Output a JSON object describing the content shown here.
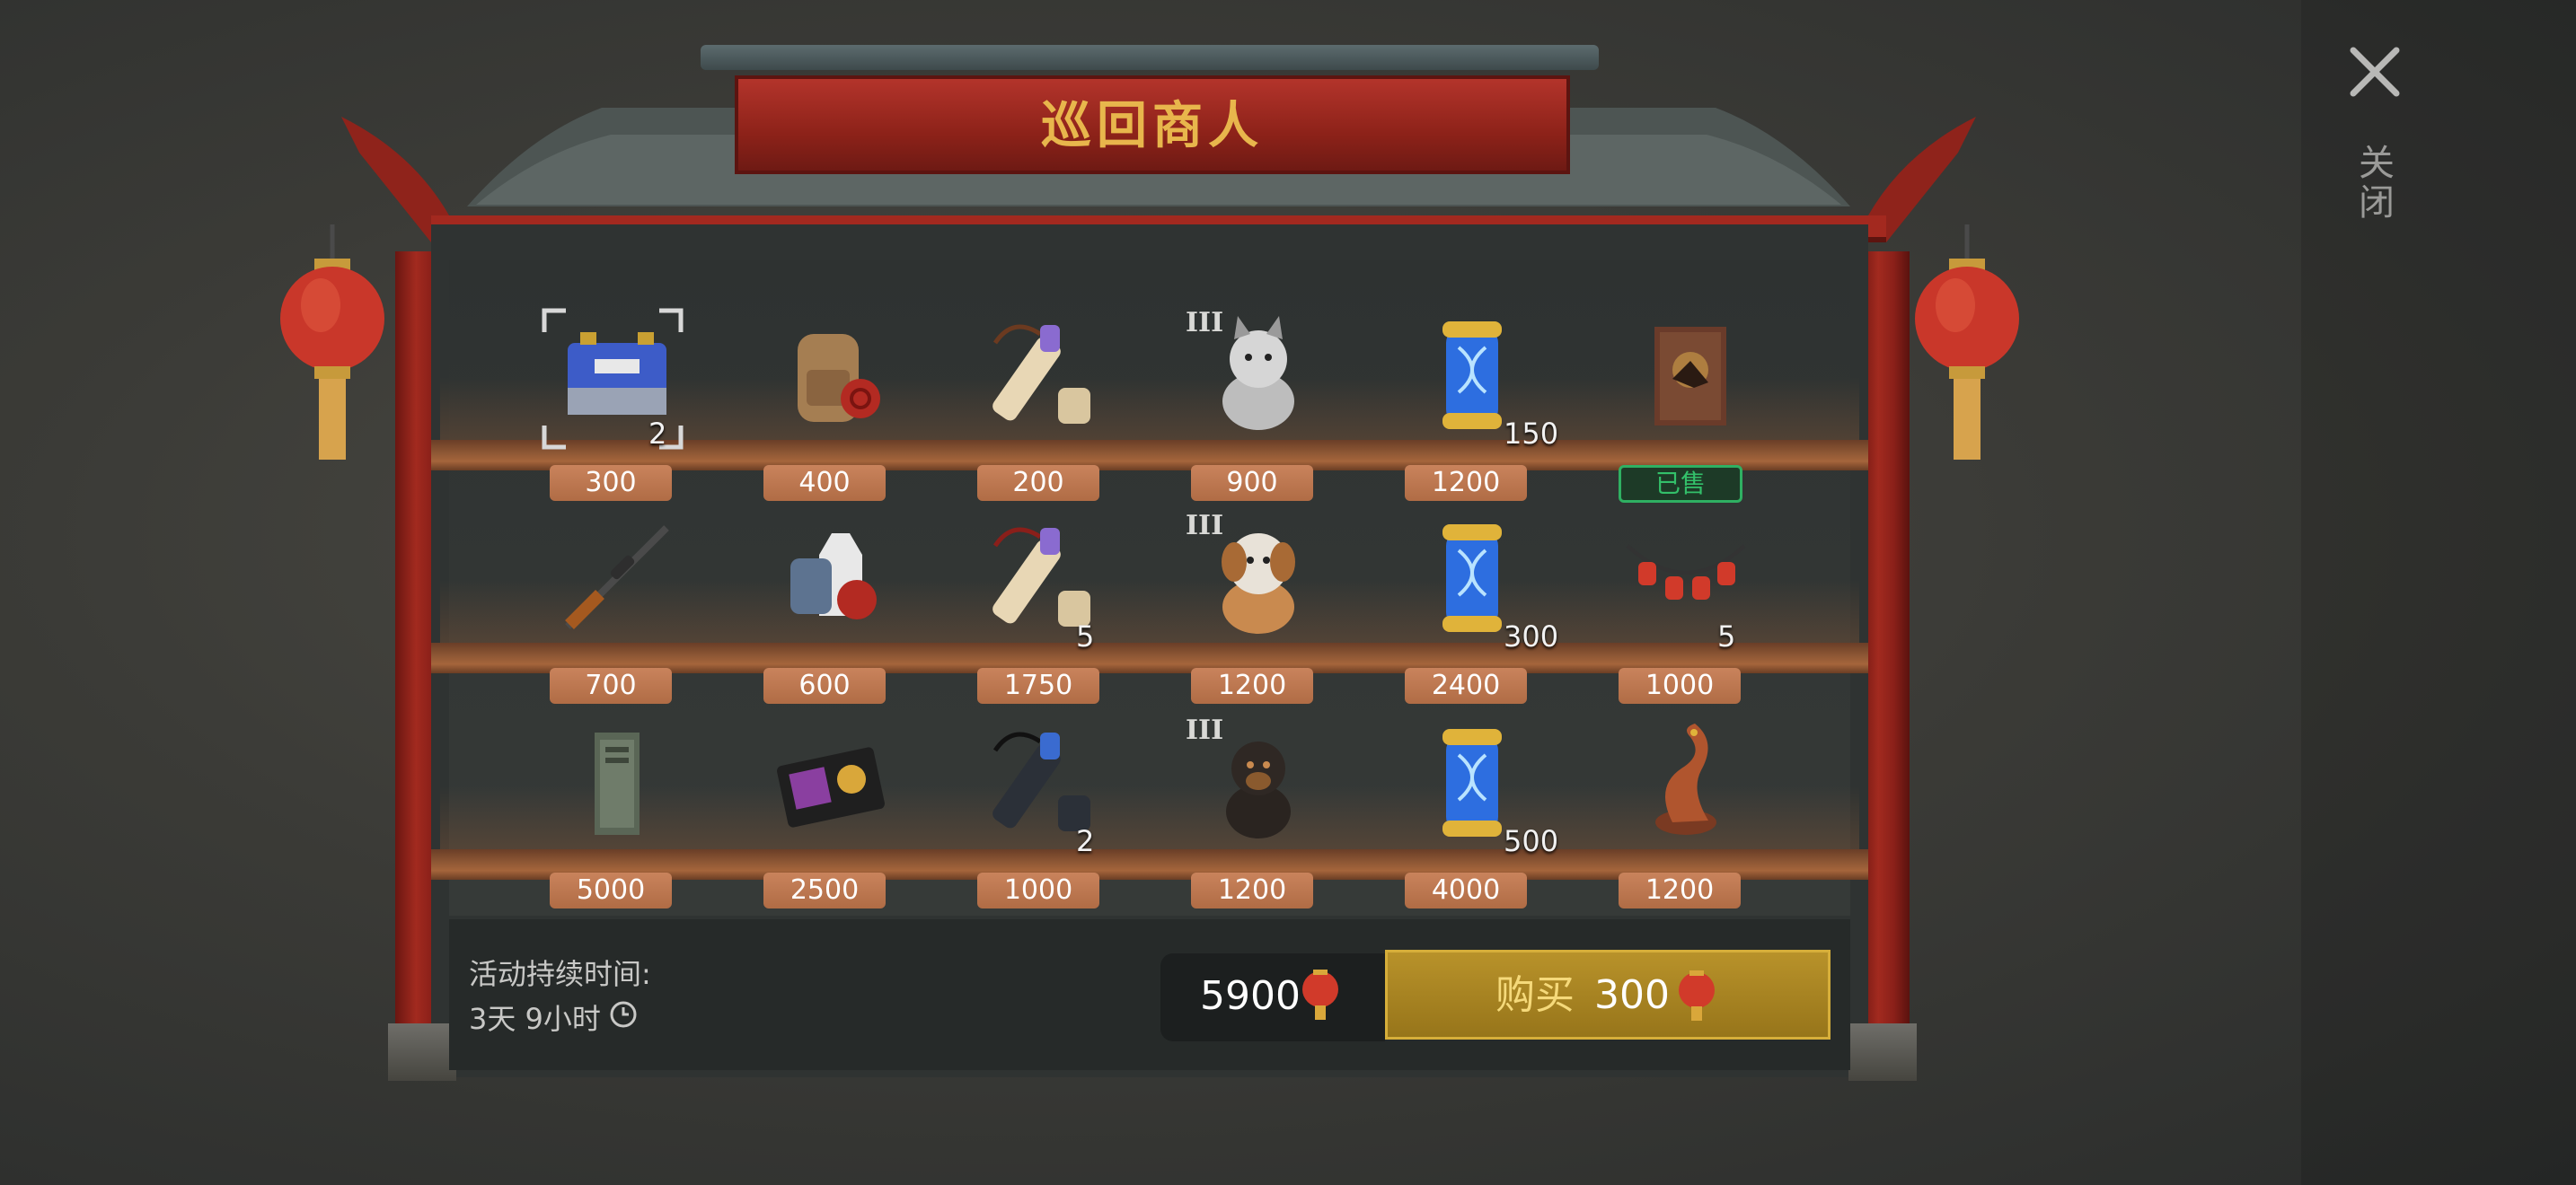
{
  "header": {
    "title": "巡回商人"
  },
  "close": {
    "label": "关闭"
  },
  "footer": {
    "duration_label": "活动持续时间:",
    "duration_value": "3天 9小时",
    "balance": "5900",
    "buy_label": "购买",
    "buy_price": "300"
  },
  "items": [
    {
      "name": "battery-item",
      "price": "300",
      "qty": "2",
      "tier": "",
      "sold": false,
      "selected": true
    },
    {
      "name": "backpack-item",
      "price": "400",
      "qty": "",
      "tier": "",
      "sold": false
    },
    {
      "name": "scroll-item",
      "price": "200",
      "qty": "",
      "tier": "",
      "sold": false
    },
    {
      "name": "husky-puppy-item",
      "price": "900",
      "qty": "",
      "tier": "III",
      "sold": false
    },
    {
      "name": "dna-capsule-item",
      "price": "1200",
      "qty": "150",
      "tier": "",
      "sold": false
    },
    {
      "name": "poster-item",
      "price": "",
      "qty": "",
      "tier": "",
      "sold": true,
      "sold_label": "已售"
    },
    {
      "name": "sniper-rifle-item",
      "price": "700",
      "qty": "",
      "tier": "",
      "sold": false
    },
    {
      "name": "vest-item",
      "price": "600",
      "qty": "",
      "tier": "",
      "sold": false
    },
    {
      "name": "scroll-item",
      "price": "1750",
      "qty": "5",
      "tier": "",
      "sold": false
    },
    {
      "name": "saint-bernard-puppy-item",
      "price": "1200",
      "qty": "",
      "tier": "III",
      "sold": false
    },
    {
      "name": "dna-capsule-item",
      "price": "2400",
      "qty": "300",
      "tier": "",
      "sold": false
    },
    {
      "name": "lantern-string-item",
      "price": "1000",
      "qty": "5",
      "tier": "",
      "sold": false
    },
    {
      "name": "locker-item",
      "price": "5000",
      "qty": "",
      "tier": "",
      "sold": false
    },
    {
      "name": "badge-wallet-item",
      "price": "2500",
      "qty": "",
      "tier": "",
      "sold": false
    },
    {
      "name": "dark-scroll-item",
      "price": "1000",
      "qty": "2",
      "tier": "",
      "sold": false
    },
    {
      "name": "rottweiler-puppy-item",
      "price": "1200",
      "qty": "",
      "tier": "III",
      "sold": false
    },
    {
      "name": "dna-capsule-item",
      "price": "4000",
      "qty": "500",
      "tier": "",
      "sold": false
    },
    {
      "name": "dragon-statue-item",
      "price": "1200",
      "qty": "",
      "tier": "",
      "sold": false
    }
  ],
  "colors": {
    "price_tag": "#b87348",
    "buy_button": "#a8861f",
    "title": "#e8b64c",
    "sold": "#33c06a"
  }
}
